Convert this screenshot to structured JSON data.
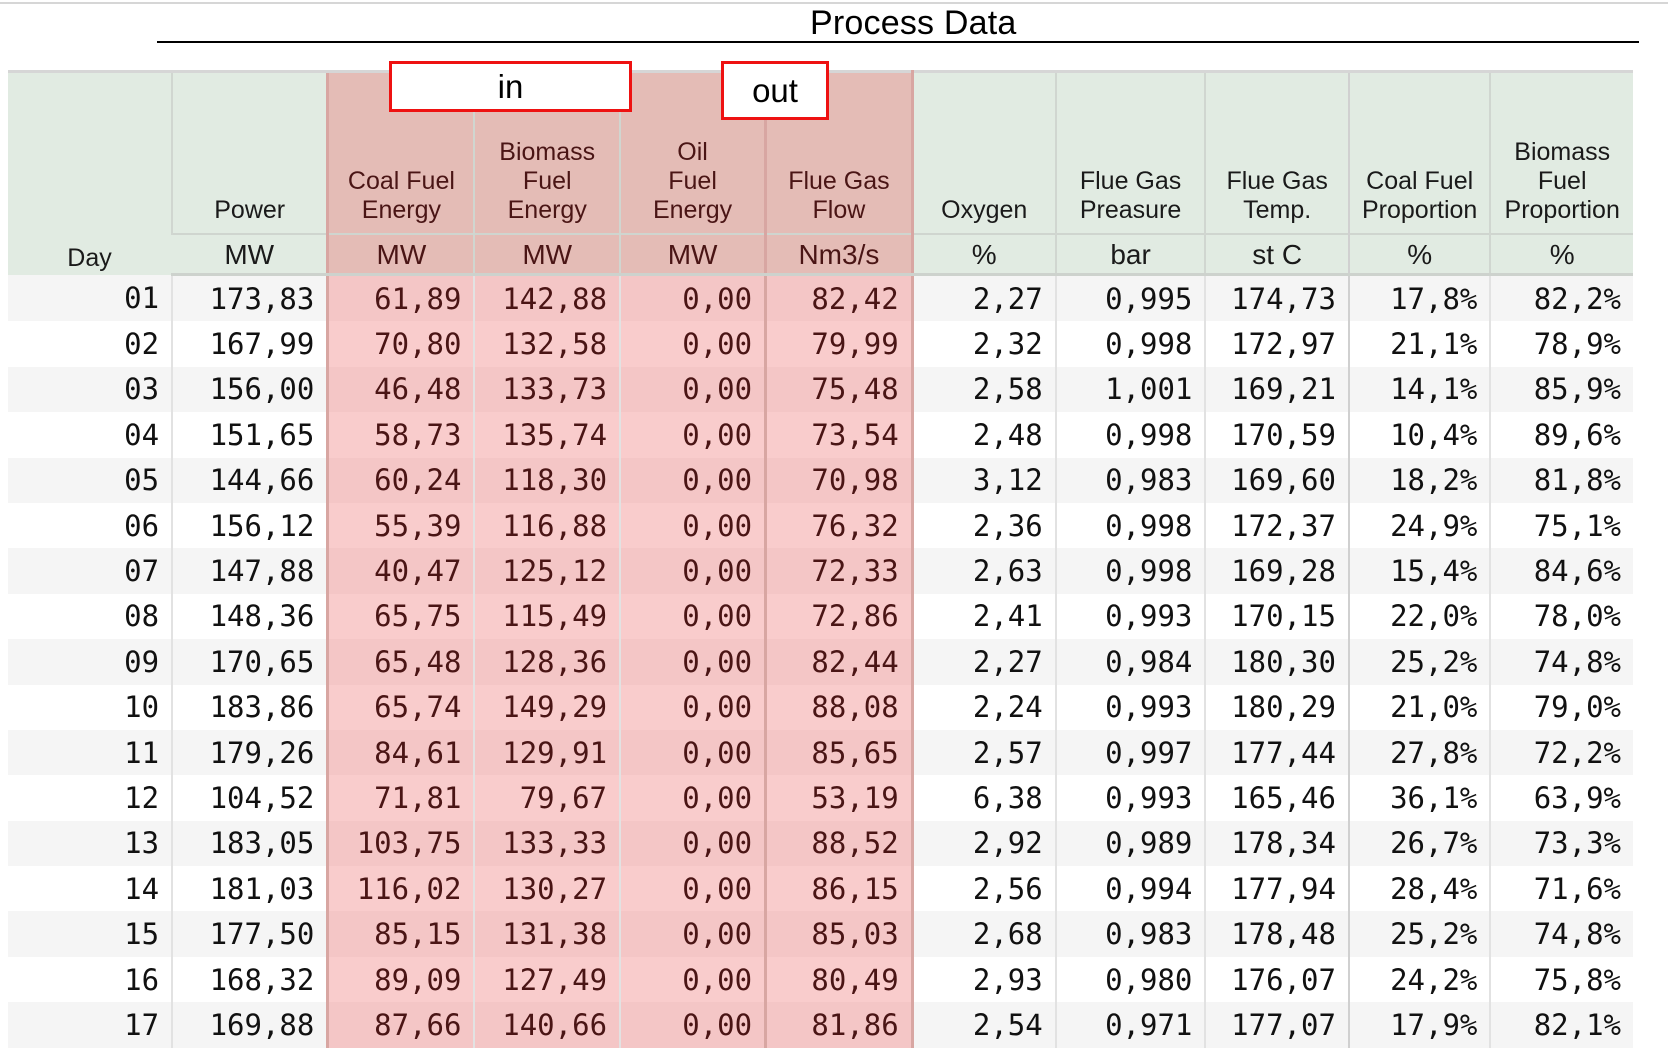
{
  "title": "Process Data",
  "groups": {
    "in": "in",
    "out": "out"
  },
  "colors": {
    "highlight": "#f4c6c6",
    "header": "#e1ebe2",
    "group_border": "#ee1111"
  },
  "columns": [
    {
      "name": "Day",
      "unit": ""
    },
    {
      "name": "Power",
      "unit": "MW"
    },
    {
      "name": "Coal Fuel\nEnergy",
      "unit": "MW"
    },
    {
      "name": "Biomass\nFuel\nEnergy",
      "unit": "MW"
    },
    {
      "name": "Oil\nFuel\nEnergy",
      "unit": "MW"
    },
    {
      "name": "Flue Gas\nFlow",
      "unit": "Nm3/s"
    },
    {
      "name": "Oxygen",
      "unit": "%"
    },
    {
      "name": "Flue Gas\nPreasure",
      "unit": "bar"
    },
    {
      "name": "Flue Gas\nTemp.",
      "unit": "st C"
    },
    {
      "name": "Coal Fuel\nProportion",
      "unit": "%"
    },
    {
      "name": "Biomass\nFuel\nProportion",
      "unit": "%"
    }
  ],
  "rows": [
    [
      "01",
      "173,83",
      "61,89",
      "142,88",
      "0,00",
      "82,42",
      "2,27",
      "0,995",
      "174,73",
      "17,8%",
      "82,2%"
    ],
    [
      "02",
      "167,99",
      "70,80",
      "132,58",
      "0,00",
      "79,99",
      "2,32",
      "0,998",
      "172,97",
      "21,1%",
      "78,9%"
    ],
    [
      "03",
      "156,00",
      "46,48",
      "133,73",
      "0,00",
      "75,48",
      "2,58",
      "1,001",
      "169,21",
      "14,1%",
      "85,9%"
    ],
    [
      "04",
      "151,65",
      "58,73",
      "135,74",
      "0,00",
      "73,54",
      "2,48",
      "0,998",
      "170,59",
      "10,4%",
      "89,6%"
    ],
    [
      "05",
      "144,66",
      "60,24",
      "118,30",
      "0,00",
      "70,98",
      "3,12",
      "0,983",
      "169,60",
      "18,2%",
      "81,8%"
    ],
    [
      "06",
      "156,12",
      "55,39",
      "116,88",
      "0,00",
      "76,32",
      "2,36",
      "0,998",
      "172,37",
      "24,9%",
      "75,1%"
    ],
    [
      "07",
      "147,88",
      "40,47",
      "125,12",
      "0,00",
      "72,33",
      "2,63",
      "0,998",
      "169,28",
      "15,4%",
      "84,6%"
    ],
    [
      "08",
      "148,36",
      "65,75",
      "115,49",
      "0,00",
      "72,86",
      "2,41",
      "0,993",
      "170,15",
      "22,0%",
      "78,0%"
    ],
    [
      "09",
      "170,65",
      "65,48",
      "128,36",
      "0,00",
      "82,44",
      "2,27",
      "0,984",
      "180,30",
      "25,2%",
      "74,8%"
    ],
    [
      "10",
      "183,86",
      "65,74",
      "149,29",
      "0,00",
      "88,08",
      "2,24",
      "0,993",
      "180,29",
      "21,0%",
      "79,0%"
    ],
    [
      "11",
      "179,26",
      "84,61",
      "129,91",
      "0,00",
      "85,65",
      "2,57",
      "0,997",
      "177,44",
      "27,8%",
      "72,2%"
    ],
    [
      "12",
      "104,52",
      "71,81",
      "79,67",
      "0,00",
      "53,19",
      "6,38",
      "0,993",
      "165,46",
      "36,1%",
      "63,9%"
    ],
    [
      "13",
      "183,05",
      "103,75",
      "133,33",
      "0,00",
      "88,52",
      "2,92",
      "0,989",
      "178,34",
      "26,7%",
      "73,3%"
    ],
    [
      "14",
      "181,03",
      "116,02",
      "130,27",
      "0,00",
      "86,15",
      "2,56",
      "0,994",
      "177,94",
      "28,4%",
      "71,6%"
    ],
    [
      "15",
      "177,50",
      "85,15",
      "131,38",
      "0,00",
      "85,03",
      "2,68",
      "0,983",
      "178,48",
      "25,2%",
      "74,8%"
    ],
    [
      "16",
      "168,32",
      "89,09",
      "127,49",
      "0,00",
      "80,49",
      "2,93",
      "0,980",
      "176,07",
      "24,2%",
      "75,8%"
    ],
    [
      "17",
      "169,88",
      "87,66",
      "140,66",
      "0,00",
      "81,86",
      "2,54",
      "0,971",
      "177,07",
      "17,9%",
      "82,1%"
    ]
  ]
}
